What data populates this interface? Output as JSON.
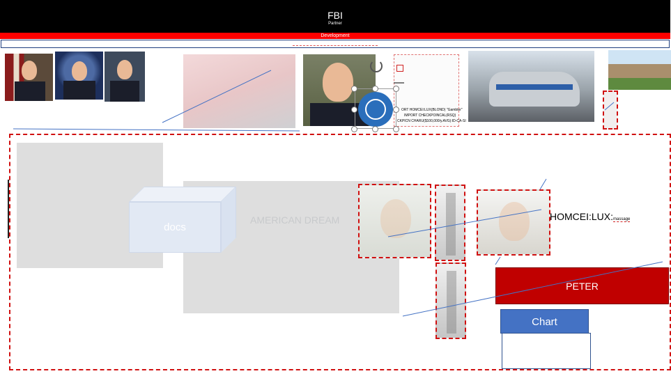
{
  "header": {
    "title": "FBI",
    "subtitle": "Partner",
    "banner": "Development"
  },
  "slide": {
    "cube_label": "docs",
    "american_dream": "AMERICAN DREAM",
    "homcei_main": "HOMCEI:LUX:",
    "homcei_small": "massage",
    "peter_label": "PETER",
    "chart_label": "Chart"
  },
  "document_card": {
    "lines": [
      "ORT HOMCEI:LUX(BLOND) \"Gambler\"",
      "IMPORT CHECKPOINCAL(RSQ)",
      "CKPICN CHARU($100,000/y.AVG):ID-CA-SI"
    ]
  },
  "icons": {
    "rotate": "rotate-handle-icon",
    "un_logo": "un-emblem-icon"
  },
  "colors": {
    "header_bg": "#000000",
    "banner_red": "#ff0000",
    "peter_red": "#c00000",
    "chart_blue": "#4472c4",
    "dash_red": "#d01010",
    "line_blue": "#4472c4"
  }
}
